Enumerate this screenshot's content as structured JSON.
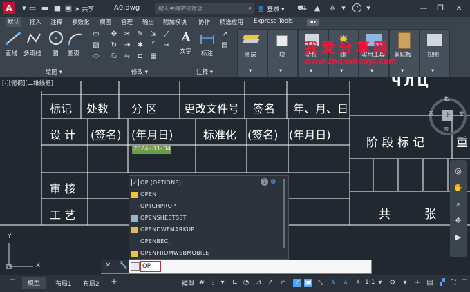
{
  "titlebar": {
    "logo": "A",
    "share": "共享",
    "doc_title": "A0.dwg",
    "search_placeholder": "键入关键字或短语",
    "login": "登录",
    "help": "?"
  },
  "tabs": [
    "默认",
    "插入",
    "注释",
    "参数化",
    "视图",
    "管理",
    "输出",
    "附加模块",
    "协作",
    "精选应用",
    "Express Tools"
  ],
  "ribbon": {
    "draw": {
      "line": "直线",
      "polyline": "多段线",
      "circle": "圆",
      "arc": "圆弧",
      "title": "绘图"
    },
    "modify": {
      "title": "修改"
    },
    "annotation": {
      "text": "文字",
      "dim": "标注",
      "title": "注释"
    },
    "layer": "图层",
    "block": "块",
    "properties": "特性",
    "groups": "组",
    "utilities": "实用工具",
    "clipboard": "剪贴板",
    "view": "视图"
  },
  "watermark": {
    "line1": "我爱分享网",
    "line2": "www.zhanshaoyi.com"
  },
  "viewport_label": "[-][俯视][二维线框]",
  "table": {
    "r1": [
      "标记",
      "处数",
      "分 区",
      "更改文件号",
      "签名",
      "年、月、日"
    ],
    "r2": [
      "设 计",
      "(签名)",
      "(年月日)",
      "标准化",
      "(签名)",
      "(年月日)"
    ],
    "date_value": "2024-03-04",
    "r4": "审 核",
    "r5": "工 艺",
    "right_stage": "阶 段 标 记",
    "right_heavy": "重",
    "right_total": "共",
    "right_sheets": "张",
    "top_right_partial": "ЧЛЦ"
  },
  "viewcube": {
    "north": "北",
    "west": "西",
    "east": "东",
    "south": "南",
    "top": "上"
  },
  "autocomplete": {
    "header": "OP (OPTIONS)",
    "items": [
      "OPEN",
      "OPTCHPROP",
      "OPENSHEETSET",
      "OPENDWFMARKUP",
      "OPENBEC_",
      "OPENFROMWEBMOBILE"
    ]
  },
  "command": {
    "input": "OP"
  },
  "ucs": {
    "y": "Y",
    "x": "X"
  },
  "statusbar": {
    "model_tab": "模型",
    "layout1": "布局1",
    "layout2": "布局2",
    "add": "+",
    "model_btn": "模型",
    "scale": "1:1"
  }
}
